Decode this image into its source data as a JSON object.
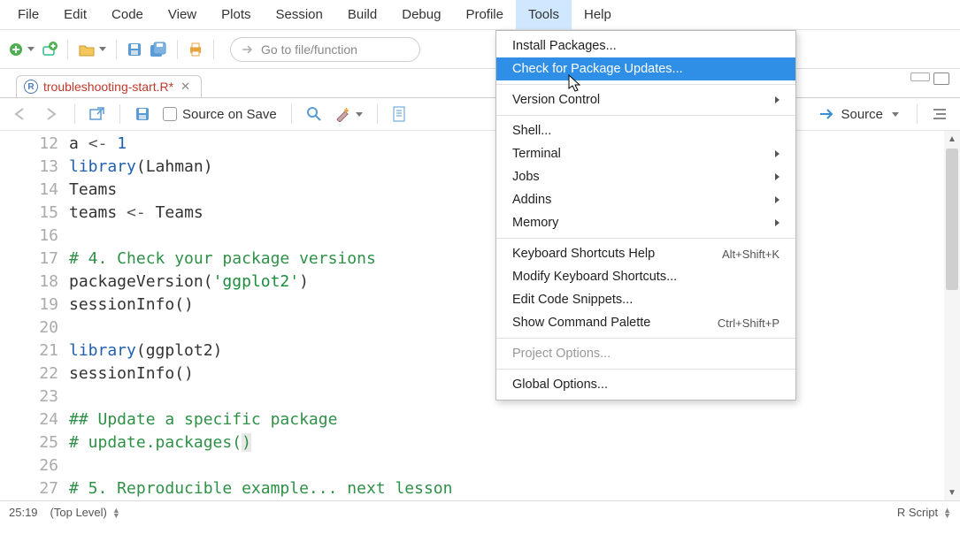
{
  "menubar": [
    "File",
    "Edit",
    "Code",
    "View",
    "Plots",
    "Session",
    "Build",
    "Debug",
    "Profile",
    "Tools",
    "Help"
  ],
  "menubar_active_index": 9,
  "toolbar": {
    "goto_placeholder": "Go to file/function"
  },
  "tab": {
    "filename": "troubleshooting-start.R*"
  },
  "editor_toolbar": {
    "source_on_save": "Source on Save",
    "source_btn": "Source"
  },
  "code": {
    "line_start": 12,
    "lines": [
      {
        "n": 12,
        "segs": [
          {
            "t": "a "
          },
          {
            "t": "<-",
            "c": "op"
          },
          {
            "t": " "
          },
          {
            "t": "1",
            "c": "num"
          }
        ]
      },
      {
        "n": 13,
        "segs": [
          {
            "t": "library",
            "c": "kw"
          },
          {
            "t": "(Lahman)"
          }
        ]
      },
      {
        "n": 14,
        "segs": [
          {
            "t": "Teams"
          }
        ]
      },
      {
        "n": 15,
        "segs": [
          {
            "t": "teams "
          },
          {
            "t": "<-",
            "c": "op"
          },
          {
            "t": " Teams"
          }
        ]
      },
      {
        "n": 16,
        "segs": []
      },
      {
        "n": 17,
        "segs": [
          {
            "t": "# 4. Check your package versions",
            "c": "com"
          }
        ]
      },
      {
        "n": 18,
        "segs": [
          {
            "t": "packageVersion("
          },
          {
            "t": "'ggplot2'",
            "c": "str"
          },
          {
            "t": ")"
          }
        ]
      },
      {
        "n": 19,
        "segs": [
          {
            "t": "sessionInfo()"
          }
        ]
      },
      {
        "n": 20,
        "segs": []
      },
      {
        "n": 21,
        "segs": [
          {
            "t": "library",
            "c": "kw"
          },
          {
            "t": "(ggplot2)"
          }
        ]
      },
      {
        "n": 22,
        "segs": [
          {
            "t": "sessionInfo()"
          }
        ]
      },
      {
        "n": 23,
        "segs": []
      },
      {
        "n": 24,
        "segs": [
          {
            "t": "## Update a specific package",
            "c": "com"
          }
        ]
      },
      {
        "n": 25,
        "segs": [
          {
            "t": "# update.packages(",
            "c": "com"
          },
          {
            "t": ")",
            "c": "com",
            "hl": true,
            "cursor": true
          }
        ]
      },
      {
        "n": 26,
        "segs": []
      },
      {
        "n": 27,
        "segs": [
          {
            "t": "# 5. Reproducible example... next lesson",
            "c": "com"
          }
        ]
      }
    ]
  },
  "status": {
    "pos": "25:19",
    "scope": "(Top Level)",
    "lang": "R Script"
  },
  "dropdown": {
    "groups": [
      [
        {
          "label": "Install Packages..."
        },
        {
          "label": "Check for Package Updates...",
          "highlight": true
        }
      ],
      [
        {
          "label": "Version Control",
          "submenu": true
        }
      ],
      [
        {
          "label": "Shell..."
        },
        {
          "label": "Terminal",
          "submenu": true
        },
        {
          "label": "Jobs",
          "submenu": true
        },
        {
          "label": "Addins",
          "submenu": true
        },
        {
          "label": "Memory",
          "submenu": true
        }
      ],
      [
        {
          "label": "Keyboard Shortcuts Help",
          "shortcut": "Alt+Shift+K"
        },
        {
          "label": "Modify Keyboard Shortcuts..."
        },
        {
          "label": "Edit Code Snippets..."
        },
        {
          "label": "Show Command Palette",
          "shortcut": "Ctrl+Shift+P"
        }
      ],
      [
        {
          "label": "Project Options...",
          "disabled": true
        }
      ],
      [
        {
          "label": "Global Options..."
        }
      ]
    ]
  }
}
